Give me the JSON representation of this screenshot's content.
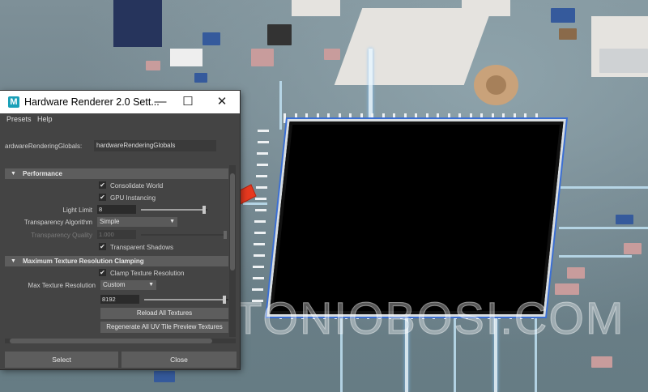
{
  "window": {
    "title": "Hardware Renderer 2.0 Sett...",
    "app_icon_letter": "M",
    "controls": {
      "minimize": "—",
      "maximize": "☐",
      "close": "✕"
    }
  },
  "menu": [
    "Presets",
    "Help"
  ],
  "globals": {
    "label": "ardwareRenderingGlobals:",
    "value": "hardwareRenderingGlobals"
  },
  "performance": {
    "header": "Performance",
    "consolidate_world": {
      "label": "Consolidate World",
      "checked": true
    },
    "gpu_instancing": {
      "label": "GPU Instancing",
      "checked": true
    },
    "light_limit": {
      "label": "Light Limit",
      "value": "8",
      "slider_fraction": 0.95
    },
    "transparency_algorithm": {
      "label": "Transparency Algorithm",
      "value": "Simple"
    },
    "transparency_quality": {
      "label": "Transparency Quality",
      "value": "1.000",
      "slider_fraction": 1.0
    },
    "transparent_shadows": {
      "label": "Transparent Shadows",
      "checked": true
    }
  },
  "texture_clamping": {
    "header": "Maximum Texture Resolution Clamping",
    "clamp": {
      "label": "Clamp Texture Resolution",
      "checked": true
    },
    "max_res": {
      "label": "Max Texture Resolution",
      "value": "Custom"
    },
    "custom_value": {
      "value": "8192",
      "slider_fraction": 0.95
    },
    "reload_button": "Reload All Textures",
    "regenerate_button": "Regenerate All UV Tile Preview Textures"
  },
  "footer": {
    "select_button": "Select",
    "close_button": "Close"
  },
  "scene": {
    "watermark": "WWW.ANTONIOBOSI.COM"
  },
  "colors": {
    "arrow": "#e8391f",
    "chip_outline": "#3b6fd4",
    "window_bg": "#444444",
    "section_bg": "#5d5d5d"
  }
}
